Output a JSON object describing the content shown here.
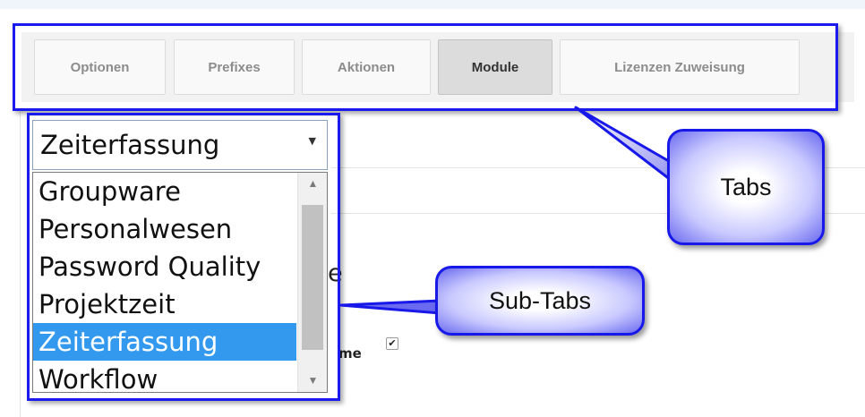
{
  "tabs": [
    {
      "label": "Optionen",
      "active": false
    },
    {
      "label": "Prefixes",
      "active": false
    },
    {
      "label": "Aktionen",
      "active": false
    },
    {
      "label": "Module",
      "active": true
    },
    {
      "label": "Lizenzen Zuweisung",
      "active": false
    }
  ],
  "module_select": {
    "selected": "Zeiterfassung",
    "options": [
      {
        "label": "Groupware",
        "selected": false
      },
      {
        "label": "Personalwesen",
        "selected": false
      },
      {
        "label": "Password Quality",
        "selected": false
      },
      {
        "label": "Projektzeit",
        "selected": false
      },
      {
        "label": "Zeiterfassung",
        "selected": true
      },
      {
        "label": "Workflow",
        "selected": false
      }
    ]
  },
  "background": {
    "partial_heading": "e",
    "partial_label": "me",
    "checkbox_checked": true
  },
  "callouts": {
    "tabs": "Tabs",
    "subtabs": "Sub-Tabs"
  },
  "colors": {
    "annotation_blue": "#1a1aee",
    "selection_blue": "#3399ee",
    "active_tab": "#dcdcdc"
  }
}
